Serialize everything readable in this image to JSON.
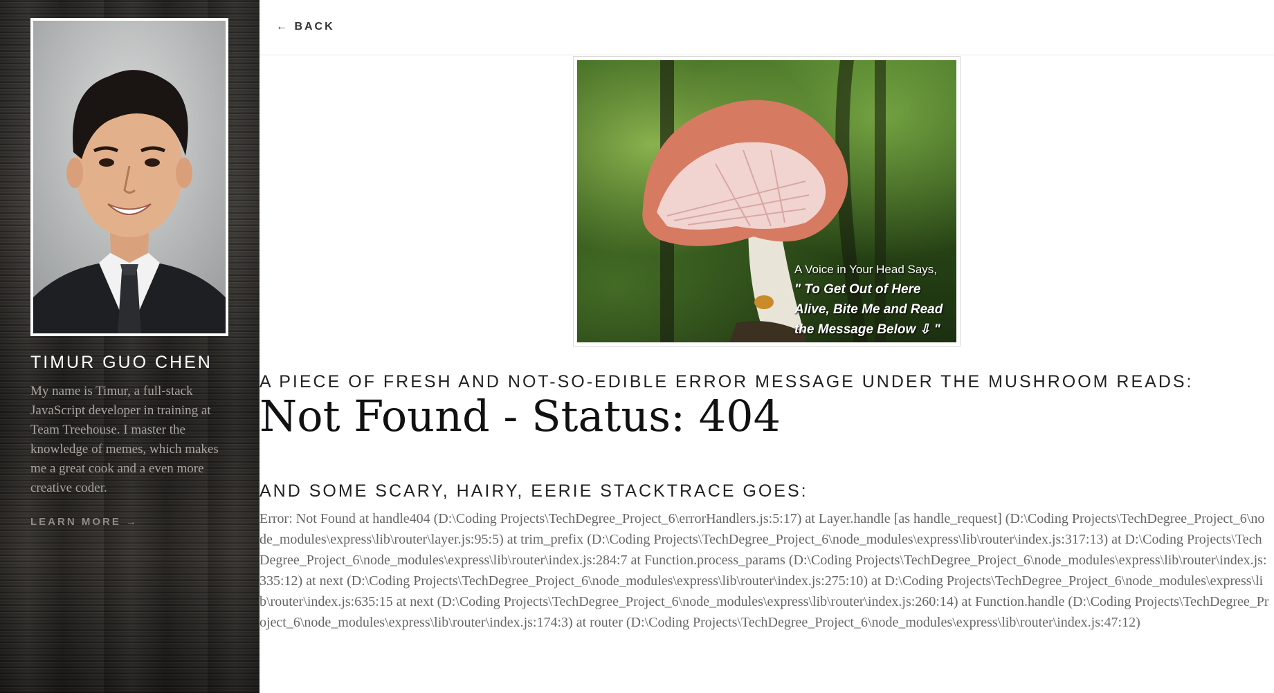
{
  "sidebar": {
    "author_name": "TIMUR GUO CHEN",
    "bio": "My name is Timur, a full-stack JavaScript developer in training at Team Treehouse. I master the knowledge of memes, which makes me a great cook and a even more creative coder.",
    "learn_more_label": "LEARN MORE →"
  },
  "topbar": {
    "back_label": "← BACK"
  },
  "mushroom": {
    "caption_line1": "A Voice in Your Head Says,",
    "caption_quote": "\" To Get Out of Here Alive, Bite Me and Read the Message Below ⇩ \""
  },
  "main": {
    "intro_heading": "A PIECE OF FRESH AND NOT-SO-EDIBLE ERROR MESSAGE UNDER THE MUSHROOM READS:",
    "error_title": "Not Found - Status: 404",
    "stack_heading": "AND SOME SCARY, HAIRY, EERIE STACKTRACE GOES:",
    "stacktrace": "Error: Not Found at handle404 (D:\\Coding Projects\\TechDegree_Project_6\\errorHandlers.js:5:17) at Layer.handle [as handle_request] (D:\\Coding Projects\\TechDegree_Project_6\\node_modules\\express\\lib\\router\\layer.js:95:5) at trim_prefix (D:\\Coding Projects\\TechDegree_Project_6\\node_modules\\express\\lib\\router\\index.js:317:13) at D:\\Coding Projects\\TechDegree_Project_6\\node_modules\\express\\lib\\router\\index.js:284:7 at Function.process_params (D:\\Coding Projects\\TechDegree_Project_6\\node_modules\\express\\lib\\router\\index.js:335:12) at next (D:\\Coding Projects\\TechDegree_Project_6\\node_modules\\express\\lib\\router\\index.js:275:10) at D:\\Coding Projects\\TechDegree_Project_6\\node_modules\\express\\lib\\router\\index.js:635:15 at next (D:\\Coding Projects\\TechDegree_Project_6\\node_modules\\express\\lib\\router\\index.js:260:14) at Function.handle (D:\\Coding Projects\\TechDegree_Project_6\\node_modules\\express\\lib\\router\\index.js:174:3) at router (D:\\Coding Projects\\TechDegree_Project_6\\node_modules\\express\\lib\\router\\index.js:47:12)"
  }
}
